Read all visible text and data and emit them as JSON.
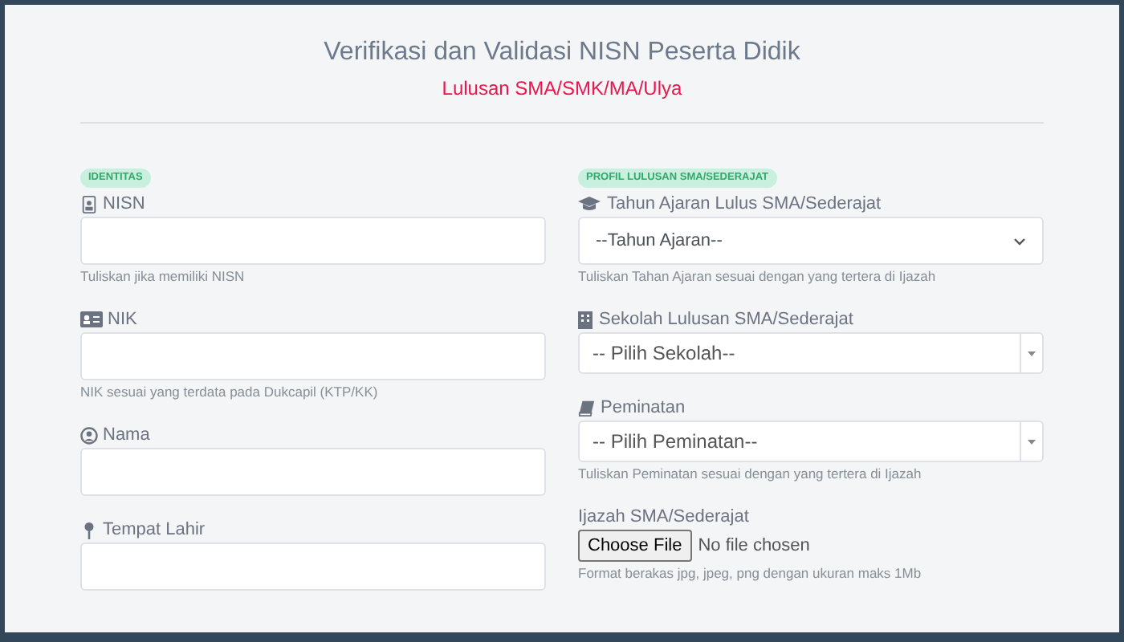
{
  "title": "Verifikasi dan Validasi NISN Peserta Didik",
  "subtitle": "Lulusan SMA/SMK/MA/Ulya",
  "columns": [
    {
      "badge": "IDENTITAS",
      "fields": [
        {
          "kind": "input",
          "label": "NISN",
          "help": "Tuliskan jika memiliki NISN"
        },
        {
          "kind": "input",
          "label": "NIK",
          "help": "NIK sesuai yang terdata pada Dukcapil (KTP/KK)"
        },
        {
          "kind": "input",
          "label": "Nama"
        },
        {
          "kind": "input",
          "label": "Tempat Lahir"
        }
      ]
    },
    {
      "badge": "PROFIL LULUSAN SMA/SEDERAJAT",
      "fields": [
        {
          "kind": "select",
          "label": "Tahun Ajaran Lulus SMA/Sederajat",
          "value": "--Tahun Ajaran--",
          "help": "Tuliskan Tahan Ajaran sesuai dengan yang tertera di Ijazah"
        },
        {
          "kind": "combo",
          "label": "Sekolah Lulusan SMA/Sederajat",
          "value": "-- Pilih Sekolah--"
        },
        {
          "kind": "combo",
          "label": "Peminatan",
          "value": "-- Pilih Peminatan--",
          "help": "Tuliskan Peminatan sesuai dengan yang tertera di Ijazah"
        },
        {
          "kind": "file",
          "label": "Ijazah SMA/Sederajat",
          "button": "Choose File",
          "status": "No file chosen",
          "help": "Format berakas jpg, jpeg, png dengan ukuran maks 1Mb"
        }
      ]
    }
  ]
}
